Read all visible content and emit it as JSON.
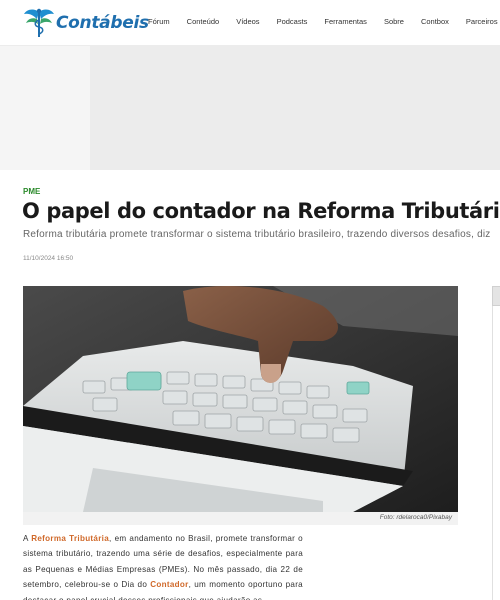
{
  "header": {
    "logo_text": "Contábeis",
    "nav": [
      "Fórum",
      "Conteúdo",
      "Vídeos",
      "Podcasts",
      "Ferramentas",
      "Sobre",
      "Contbox",
      "Parceiros"
    ]
  },
  "article": {
    "category": "PME",
    "title": "O papel do contador na Reforma Tributária",
    "subtitle": "Reforma tributária promete transformar o sistema tributário brasileiro, trazendo diversos desafios, diz",
    "date": "11/10/2024 16:50",
    "image_caption": "Foto: rdelaroca0/Pixabay",
    "body": {
      "p1_a": "A ",
      "p1_link1": "Reforma Tributária",
      "p1_b": ", em andamento no Brasil, promete transformar o sistema tributário, trazendo uma série de desafios, especialmente para as Pequenas e Médias Empresas (PMEs). No mês passado, dia 22 de setembro, celebrou-se o Dia do ",
      "p1_link2": "Contador",
      "p1_c": ", um momento oportuno para destacar o papel crucial desses profissionais que ajudarão as"
    }
  },
  "colors": {
    "brand_blue": "#1f6fae",
    "category_green": "#2b8a2b",
    "link_orange": "#d0692a"
  }
}
